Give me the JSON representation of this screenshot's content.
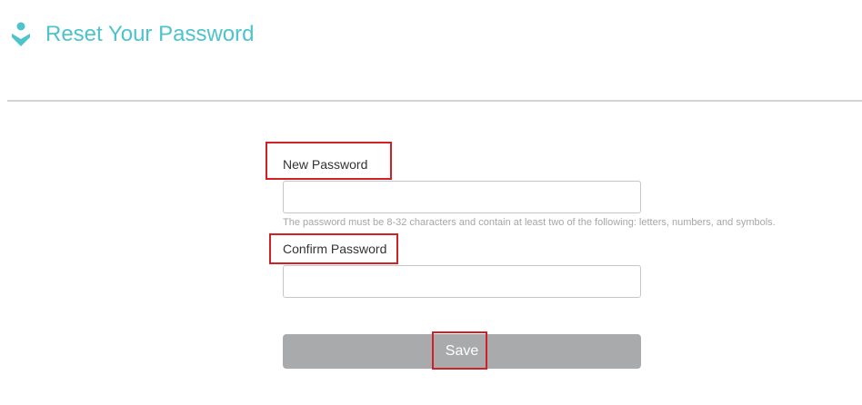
{
  "header": {
    "title": "Reset Your Password",
    "icon": "user-icon",
    "accent_color": "#4dc3cc"
  },
  "form": {
    "new_password": {
      "label": "New Password",
      "value": "",
      "hint": "The password must be 8-32 characters and contain at least two of the following: letters, numbers, and symbols."
    },
    "confirm_password": {
      "label": "Confirm Password",
      "value": ""
    },
    "save_label": "Save",
    "save_button_color": "#a9aaac",
    "highlight_color": "#d32027"
  }
}
